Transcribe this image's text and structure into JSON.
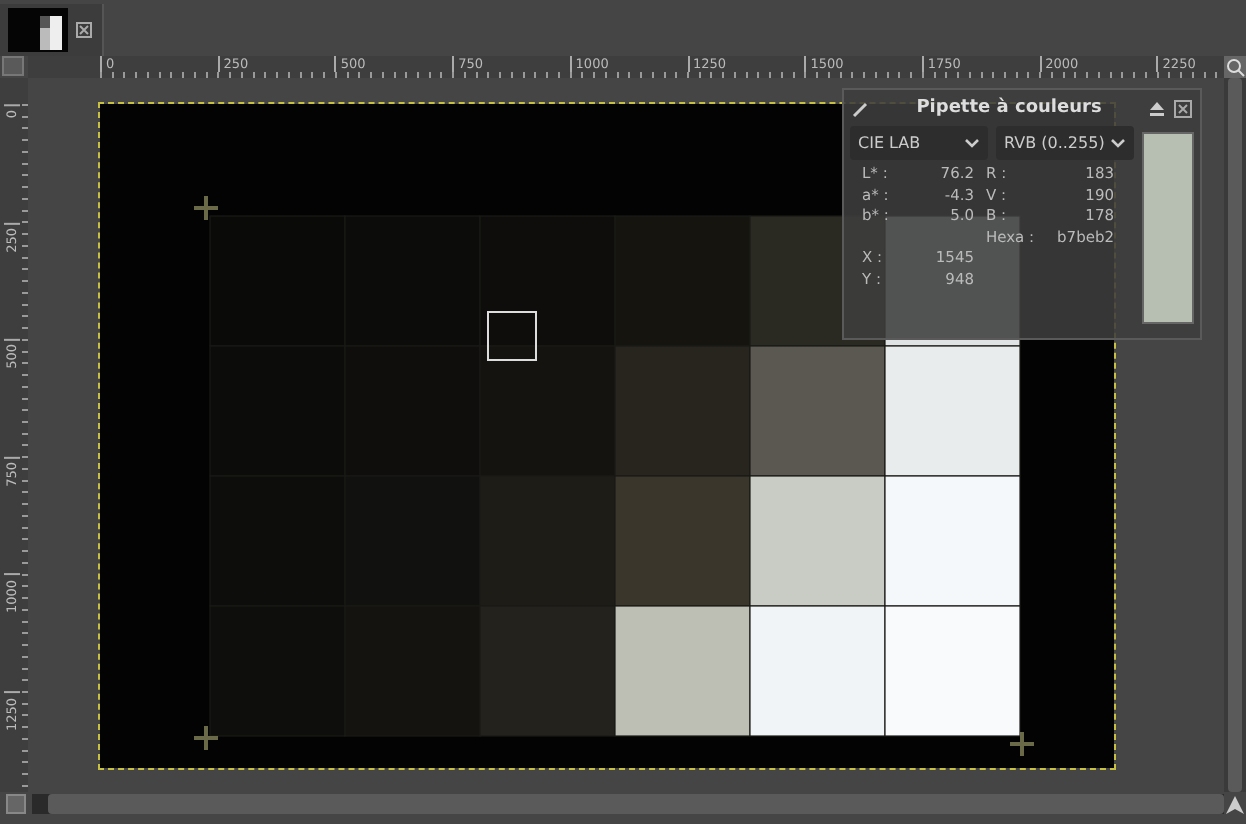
{
  "ruler_horizontal": [
    "0",
    "250",
    "500",
    "750",
    "1000",
    "1250",
    "1500",
    "1750",
    "2000",
    "2250"
  ],
  "ruler_vertical": [
    "0",
    "250",
    "500",
    "750",
    "1000",
    "1250"
  ],
  "color_picker": {
    "title": "Pipette à couleurs",
    "dropdowns": [
      "CIE LAB",
      "RVB (0..255)"
    ],
    "lab_values": [
      {
        "label": "L* :",
        "value": "76.2"
      },
      {
        "label": "a* :",
        "value": "-4.3"
      },
      {
        "label": "b* :",
        "value": "5.0"
      }
    ],
    "rgb_values": [
      {
        "label": "R :",
        "value": "183"
      },
      {
        "label": "V :",
        "value": "190"
      },
      {
        "label": "B :",
        "value": "178"
      }
    ],
    "hex": {
      "label": "Hexa :",
      "value": "b7beb2"
    },
    "position": [
      {
        "label": "X :",
        "value": "1545"
      },
      {
        "label": "Y :",
        "value": "948"
      }
    ]
  }
}
